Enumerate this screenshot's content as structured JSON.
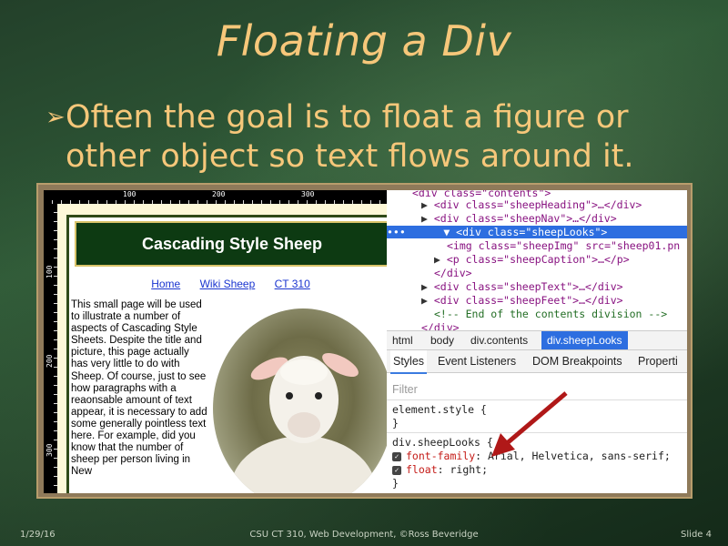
{
  "slide": {
    "title": "Floating a Div",
    "bullet": "Often the goal is to float a figure or other object so text flows around it."
  },
  "webpage": {
    "heading": "Cascading Style Sheep",
    "nav": [
      "Home",
      "Wiki Sheep",
      "CT 310"
    ],
    "text": "This small page will be used to illustrate a number of aspects of Cascading Style Sheets. Despite the title and picture, this page actually has very little to do with Sheep. Of course, just to see how paragraphs with a reaonsable amount of text appear, it is necessary to add some generally pointless text here. For example, did you know that the number of sheep per person living in New",
    "ruler_top": [
      "100",
      "200",
      "300"
    ],
    "ruler_left": [
      "100",
      "200",
      "300"
    ]
  },
  "devtools": {
    "dom_lines": [
      "<div class=\"contents\">",
      "<div class=\"sheepHeading\">…</div>",
      "<div class=\"sheepNav\">…</div>",
      "<div class=\"sheepLooks\">",
      "<img class=\"sheepImg\" src=\"sheep01.pn",
      "<p class=\"sheepCaption\">…</p>",
      "</div>",
      "<div class=\"sheepText\">…</div>",
      "<div class=\"sheepFeet\">…</div>",
      "<!-- End of the contents division -->",
      "</div>"
    ],
    "dots": "•••",
    "breadcrumbs": [
      "html",
      "body",
      "div.contents",
      "div.sheepLooks"
    ],
    "tabs": [
      "Styles",
      "Event Listeners",
      "DOM Breakpoints",
      "Properti"
    ],
    "filter_placeholder": "Filter",
    "element_style_open": "element.style {",
    "close_brace": "}",
    "rule_selector": "div.sheepLooks {",
    "prop1_name": "font-family",
    "prop1_value": ": Arial, Helvetica, sans-serif;",
    "prop2_name": "float",
    "prop2_value": ": right;",
    "checkmark": "✓"
  },
  "footer": {
    "date": "1/29/16",
    "course": "CSU CT 310, Web Development, ©Ross Beveridge",
    "slide_num": "Slide 4"
  },
  "colors": {
    "title": "#f6c77a",
    "selection": "#2d6ee0",
    "arrow": "#b01818"
  }
}
